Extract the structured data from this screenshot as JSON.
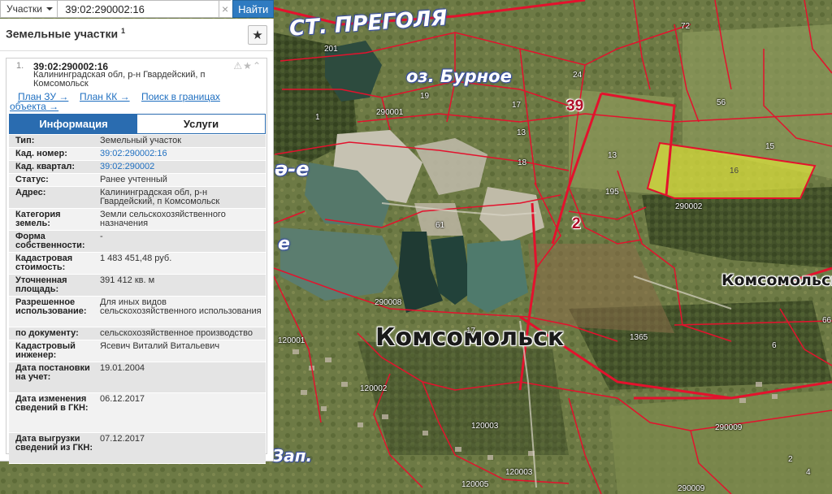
{
  "search": {
    "category": "Участки",
    "query": "39:02:290002:16",
    "clear_glyph": "×",
    "submit_label": "Найти"
  },
  "panel": {
    "title": "Земельные участки",
    "count": "1",
    "favorite_icon": "star-icon"
  },
  "result": {
    "index": "1.",
    "cad_id": "39:02:290002:16",
    "address": "Калининградская обл, р-н Гвардейский, п Комсомольск",
    "links": {
      "plan_zu": "План ЗУ →",
      "plan_kk": "План КК →",
      "search_bounds": "Поиск в границах объекта →"
    },
    "tabs": [
      "Информация",
      "Услуги"
    ],
    "active_tab": 0,
    "props": [
      {
        "key": "Тип:",
        "value": "Земельный участок",
        "link": false
      },
      {
        "key": "Кад. номер:",
        "value": "39:02:290002:16",
        "link": true
      },
      {
        "key": "Кад. квартал:",
        "value": "39:02:290002",
        "link": true
      },
      {
        "key": "Статус:",
        "value": "Ранее учтенный",
        "link": false
      },
      {
        "key": "Адрес:",
        "value": "Калининградская обл, р-н Гвардейский, п Комсомольск",
        "link": false
      },
      {
        "key": "Категория земель:",
        "value": "Земли сельскохозяйственного назначения",
        "link": false
      },
      {
        "key": "Форма собственности:",
        "value": "-",
        "link": false
      },
      {
        "key": "Кадастровая стоимость:",
        "value": "1 483 451,48 руб.",
        "link": false
      },
      {
        "key": "Уточненная площадь:",
        "value": "391 412 кв. м",
        "link": false
      },
      {
        "key": "Разрешенное использование:",
        "value": "Для иных видов сельскохозяйственного использования",
        "link": false
      },
      {
        "key": "по документу:",
        "value": "сельскохозяйственное производство",
        "link": false
      },
      {
        "key": "Кадастровый инженер:",
        "value": "Ясевич Виталий Витальевич",
        "link": false
      },
      {
        "key": "Дата постановки на учет:",
        "value": "19.01.2004",
        "link": false
      },
      {
        "key": "Дата изменения сведений в ГКН:",
        "value": "06.12.2017",
        "link": false
      },
      {
        "key": "Дата выгрузки сведений из ГКН:",
        "value": "07.12.2017",
        "link": false
      }
    ]
  },
  "map": {
    "labels": {
      "station": "СТ. ПРЕГОЛЯ",
      "lake": "оз. Бурное",
      "town_main": "Комсомольск",
      "town_small": "Комсомольск",
      "bottom_street": "Зап.",
      "left_fragment_1": "ә-е",
      "left_fragment_2": "е"
    },
    "quarters": [
      "39",
      "2"
    ],
    "parcels": [
      "201",
      "19",
      "17",
      "13",
      "18",
      "13",
      "24",
      "72",
      "56",
      "15",
      "16",
      "195",
      "290002",
      "290001",
      "1",
      "61",
      "290008",
      "1365",
      "120002",
      "120003",
      "120003",
      "120005",
      "290009",
      "290009",
      "66",
      "4",
      "120001",
      "17",
      "6",
      "2"
    ],
    "highlight_color": "#d8de3c",
    "boundary_color": "#e3122d"
  }
}
